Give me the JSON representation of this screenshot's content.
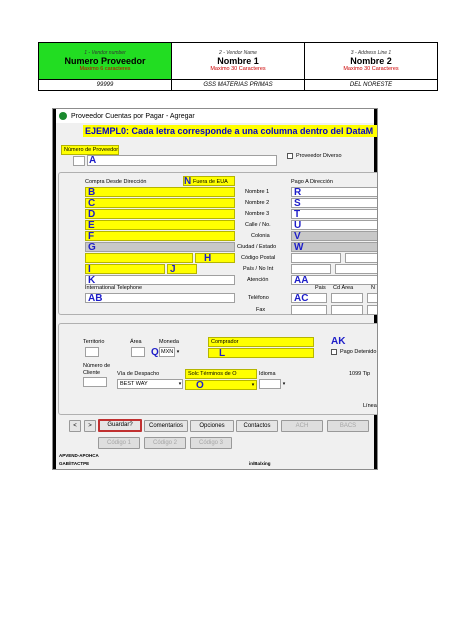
{
  "sheet": {
    "headers": [
      {
        "small": "1 - Vendor number",
        "big": "Numero Proveedor",
        "note": "Maximo 6 caracteres"
      },
      {
        "small": "2 - Vendor Name",
        "big": "Nombre 1",
        "note": "Maximo 30 Caracteres"
      },
      {
        "small": "3 - Address Line 1",
        "big": "Nombre 2",
        "note": "Maximo 30 Caracteres"
      }
    ],
    "values": [
      "99999",
      "GSS MATERIAS PRIMAS",
      "DEL NORESTE"
    ]
  },
  "window": {
    "title": "Proveedor Cuentas por Pagar - Agregar",
    "banner": "EJEMPL0: Cada letra corresponde a una columna dentro del DataM",
    "vendor_number_label": "Número de Proveedor",
    "vendor_letter": "A",
    "diverse_label": "Proveedor Diverso"
  },
  "purchase_address": {
    "label": "Compra Desde Dirección",
    "outside_us_letter": "N",
    "outside_us_label": "Fuera de EUA",
    "letters": [
      "B",
      "C",
      "D",
      "E",
      "F",
      "G"
    ],
    "letter_h": "H",
    "letter_i": "I",
    "letter_j": "J",
    "letter_k": "K"
  },
  "field_labels": [
    "Nombre 1",
    "Nombre 2",
    "Nombre 3",
    "Calle / No.",
    "Colonia",
    "Ciudad / Estado",
    "Código Postal",
    "País / No Int",
    "Atención"
  ],
  "payment_address": {
    "label": "Pago A Dirección",
    "letters": [
      "R",
      "S",
      "T",
      "U",
      "V",
      "W"
    ],
    "letter_aa": "AA"
  },
  "intl_phone": {
    "label": "International Telephone",
    "letter": "AB"
  },
  "phone": {
    "label": "Teléfono",
    "fax_label": "Fax",
    "letter": "AC"
  },
  "phone_cols": {
    "pais": "Pais",
    "area": "Cd Área",
    "num": "N"
  },
  "territory": {
    "label": "Territorio",
    "area_label": "Área",
    "currency_label": "Moneda",
    "currency_letter": "Q",
    "currency_value": "MXN"
  },
  "buyer": {
    "label": "Comprador",
    "letter": "L",
    "ak": "AK",
    "hold_label": "Pago Detenido"
  },
  "customer_number": {
    "label": "Número de Cliente"
  },
  "ship_via": {
    "label": "Vía de Despacho",
    "value": "BEST WAY"
  },
  "terms": {
    "label": "Solc Términos de O",
    "letter": "O",
    "lang_label": "Idioma",
    "tip": "1099 Tip",
    "line": "Línea"
  },
  "buttons": {
    "prev": "<",
    "next": ">",
    "save": "Guardar?",
    "comments": "Comentarios",
    "options": "Opciones",
    "contacts": "Contactos",
    "ach": "ACH",
    "bacs": "BACS",
    "code1": "Código 1",
    "code2": "Código 2",
    "code3": "Código 3"
  },
  "footer": {
    "left1": "APVEND-APOHCA",
    "left2": "GAB/ITACTPE",
    "right": "in/Ba/xing"
  }
}
